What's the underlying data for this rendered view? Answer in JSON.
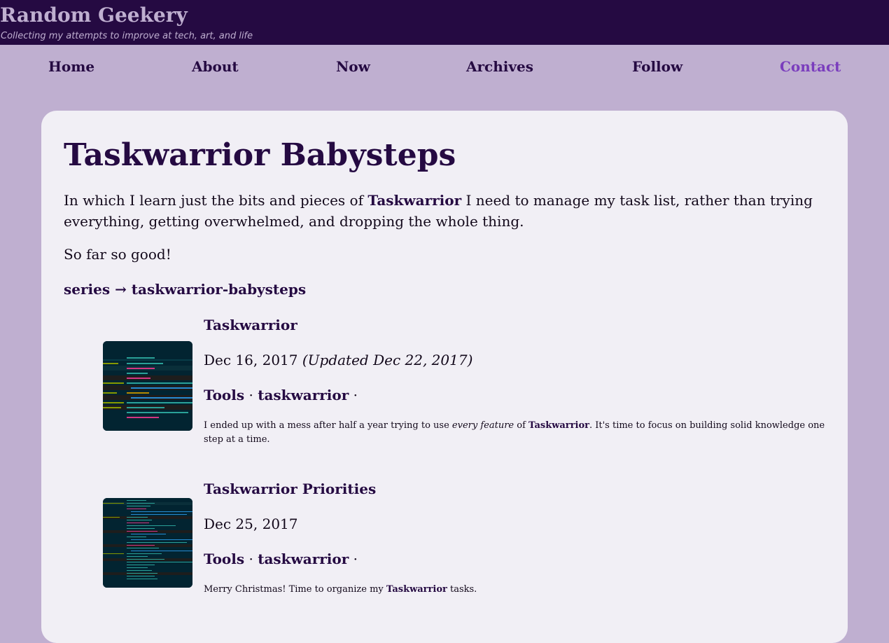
{
  "site": {
    "title": "Random Geekery",
    "tagline": "Collecting my attempts to improve at tech, art, and life"
  },
  "nav": {
    "home": "Home",
    "about": "About",
    "now": "Now",
    "archives": "Archives",
    "follow": "Follow",
    "contact": "Contact"
  },
  "colors": {
    "header_bg": "#250a42",
    "page_bg": "#bfafd0",
    "card_bg": "#f1eff5",
    "link": "#250a42",
    "active_link": "#7a3dbd",
    "thumb_bg": "#022431"
  },
  "page": {
    "title": "Taskwarrior Babysteps",
    "intro_before": "In which I learn just the bits and pieces of ",
    "intro_link": "Taskwarrior",
    "intro_after": " I need to manage my task list, rather than trying everything, getting overwhelmed, and dropping the whole thing.",
    "so_far": "So far so good!",
    "series_link": "series → taskwarrior-babysteps"
  },
  "entries": [
    {
      "title": "Taskwarrior",
      "date": "Dec 16, 2017",
      "updated": "(Updated Dec 22, 2017)",
      "tag1": "Tools",
      "tag2": "taskwarrior",
      "sep": "·",
      "summary_a": "I ended up with a mess after half a year trying to use ",
      "summary_em": "every feature",
      "summary_b": " of ",
      "summary_link": "Taskwarrior",
      "summary_c": ". It's time to focus on building solid knowledge one step at a time.",
      "thumb_icon": "terminal-screenshot-icon"
    },
    {
      "title": "Taskwarrior Priorities",
      "date": "Dec 25, 2017",
      "tag1": "Tools",
      "tag2": "taskwarrior",
      "sep": "·",
      "summary_a": "Merry Christmas! Time to organize my ",
      "summary_link": "Taskwarrior",
      "summary_c": " tasks.",
      "thumb_icon": "terminal-screenshot-icon"
    }
  ]
}
